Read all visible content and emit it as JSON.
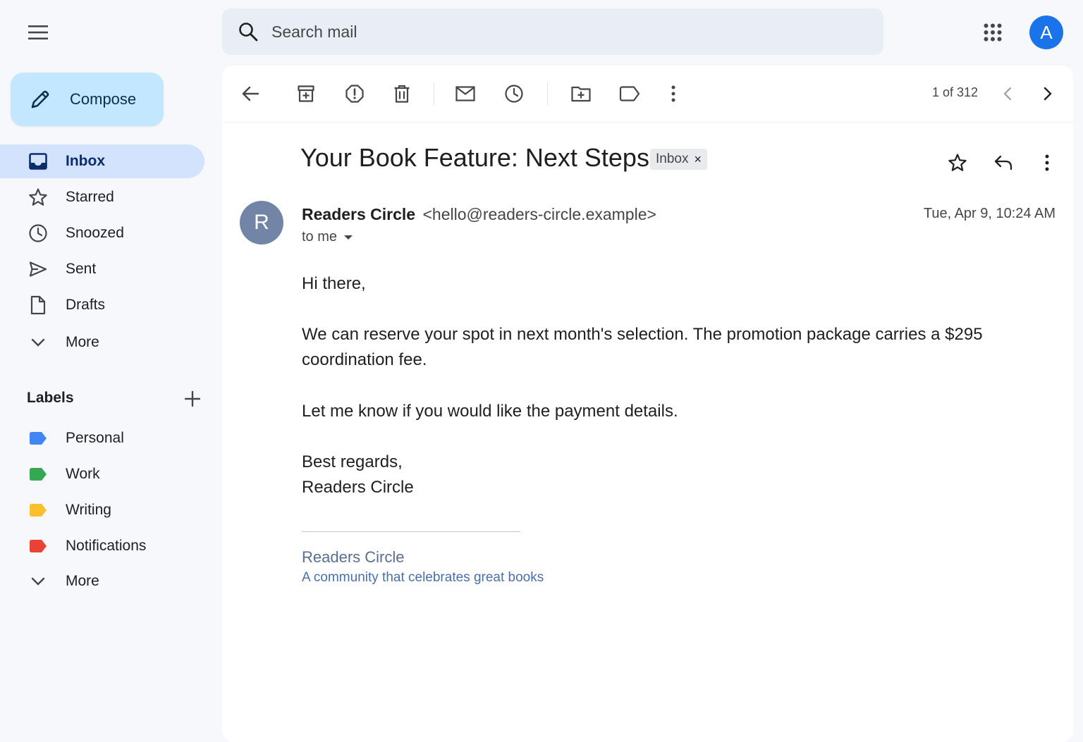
{
  "search": {
    "placeholder": "Search mail"
  },
  "account": {
    "initial": "A",
    "color": "#1a73e8"
  },
  "compose": {
    "label": "Compose"
  },
  "sidebar": {
    "items": [
      {
        "label": "Inbox",
        "icon": "inbox-icon",
        "active": true
      },
      {
        "label": "Starred",
        "icon": "star-icon"
      },
      {
        "label": "Snoozed",
        "icon": "clock-icon"
      },
      {
        "label": "Sent",
        "icon": "send-icon"
      },
      {
        "label": "Drafts",
        "icon": "draft-icon"
      },
      {
        "label": "More",
        "icon": "chevron-down-icon"
      }
    ],
    "labels_heading": "Labels",
    "labels": [
      {
        "label": "Personal",
        "color": "#4285f4"
      },
      {
        "label": "Work",
        "color": "#34a853"
      },
      {
        "label": "Writing",
        "color": "#fbc02d"
      },
      {
        "label": "Notifications",
        "color": "#ea4335"
      }
    ],
    "labels_more": "More"
  },
  "toolbar": {
    "pager": "1 of 312"
  },
  "email": {
    "subject": "Your Book Feature: Next Steps",
    "chip": "Inbox",
    "chip_close": "×",
    "sender_initial": "R",
    "sender_name": "Readers Circle",
    "sender_email": "<hello@readers-circle.example>",
    "to": "to me",
    "date": "Tue, Apr 9, 10:24 AM",
    "body": [
      "Hi there,",
      "We can reserve your spot in next month's selection. The promotion package carries a $295 coordination fee.",
      "Let me know if you would like the payment details.",
      "Best regards,",
      "Readers Circle"
    ],
    "signature_name": "Readers Circle",
    "signature_tagline": "A community that celebrates great books"
  }
}
